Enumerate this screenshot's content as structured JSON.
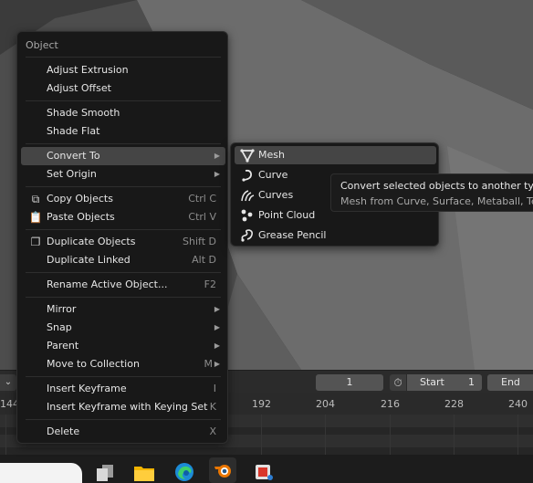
{
  "menu": {
    "title": "Object",
    "items": [
      {
        "label": "Adjust Extrusion"
      },
      {
        "label": "Adjust Offset"
      },
      {
        "label": "Shade Smooth"
      },
      {
        "label": "Shade Flat"
      },
      {
        "label": "Convert To"
      },
      {
        "label": "Set Origin"
      },
      {
        "label": "Copy Objects",
        "shortcut": "Ctrl C",
        "icon": "copy-icon"
      },
      {
        "label": "Paste Objects",
        "shortcut": "Ctrl V",
        "icon": "paste-icon"
      },
      {
        "label": "Duplicate Objects",
        "shortcut": "Shift D",
        "icon": "duplicate-icon"
      },
      {
        "label": "Duplicate Linked",
        "shortcut": "Alt D"
      },
      {
        "label": "Rename Active Object...",
        "shortcut": "F2"
      },
      {
        "label": "Mirror"
      },
      {
        "label": "Snap"
      },
      {
        "label": "Parent"
      },
      {
        "label": "Move to Collection",
        "shortcut": "M"
      },
      {
        "label": "Insert Keyframe",
        "shortcut": "I"
      },
      {
        "label": "Insert Keyframe with Keying Set",
        "shortcut": "K"
      },
      {
        "label": "Delete",
        "shortcut": "X"
      }
    ]
  },
  "submenu": {
    "items": [
      {
        "label": "Mesh",
        "icon": "mesh-icon"
      },
      {
        "label": "Curve",
        "icon": "curve-icon"
      },
      {
        "label": "Curves",
        "icon": "curves-icon"
      },
      {
        "label": "Point Cloud",
        "icon": "point-cloud-icon"
      },
      {
        "label": "Grease Pencil",
        "icon": "grease-pencil-icon"
      }
    ]
  },
  "tooltip": {
    "title": "Convert selected objects to another type",
    "detail": "Mesh from Curve, Surface, Metaball, Tex"
  },
  "timeline": {
    "current_frame": "1",
    "start_label": "Start",
    "start_value": "1",
    "end_label": "End",
    "ticks": [
      "144",
      "192",
      "204",
      "216",
      "228",
      "240"
    ]
  },
  "taskbar": {
    "apps": [
      "task-view-icon",
      "file-explorer-icon",
      "edge-icon",
      "blender-icon",
      "snipping-tool-icon"
    ]
  }
}
